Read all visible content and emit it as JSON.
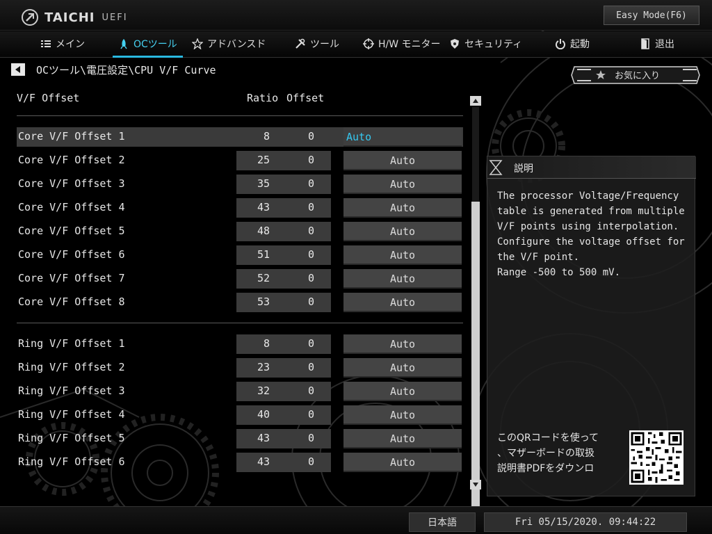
{
  "header": {
    "brand": "TAICHI",
    "brand_sub": "UEFI",
    "easy_mode_label": "Easy Mode(F6)"
  },
  "nav": {
    "tabs": [
      {
        "label": "メイン",
        "icon": "list-icon"
      },
      {
        "label": "OCツール",
        "icon": "rocket-icon",
        "active": true
      },
      {
        "label": "アドバンスド",
        "icon": "star-icon"
      },
      {
        "label": "ツール",
        "icon": "tools-icon"
      },
      {
        "label": "H/W モニター",
        "icon": "crosshair-icon"
      },
      {
        "label": "セキュリティ",
        "icon": "shield-icon"
      },
      {
        "label": "起動",
        "icon": "power-icon"
      },
      {
        "label": "退出",
        "icon": "exit-door-icon"
      }
    ]
  },
  "breadcrumb": "OCツール\\電圧設定\\CPU V/F Curve",
  "favorites_label": "お気に入り",
  "list": {
    "headers": {
      "name": "V/F Offset",
      "ratio": "Ratio",
      "offset": "Offset"
    },
    "core_rows": [
      {
        "name": "Core V/F Offset 1",
        "ratio": "8",
        "offset": "0",
        "value": "Auto"
      },
      {
        "name": "Core V/F Offset 2",
        "ratio": "25",
        "offset": "0",
        "value": "Auto"
      },
      {
        "name": "Core V/F Offset 3",
        "ratio": "35",
        "offset": "0",
        "value": "Auto"
      },
      {
        "name": "Core V/F Offset 4",
        "ratio": "43",
        "offset": "0",
        "value": "Auto"
      },
      {
        "name": "Core V/F Offset 5",
        "ratio": "48",
        "offset": "0",
        "value": "Auto"
      },
      {
        "name": "Core V/F Offset 6",
        "ratio": "51",
        "offset": "0",
        "value": "Auto"
      },
      {
        "name": "Core V/F Offset 7",
        "ratio": "52",
        "offset": "0",
        "value": "Auto"
      },
      {
        "name": "Core V/F Offset 8",
        "ratio": "53",
        "offset": "0",
        "value": "Auto"
      }
    ],
    "ring_rows": [
      {
        "name": "Ring V/F Offset 1",
        "ratio": "8",
        "offset": "0",
        "value": "Auto"
      },
      {
        "name": "Ring V/F Offset 2",
        "ratio": "23",
        "offset": "0",
        "value": "Auto"
      },
      {
        "name": "Ring V/F Offset 3",
        "ratio": "32",
        "offset": "0",
        "value": "Auto"
      },
      {
        "name": "Ring V/F Offset 4",
        "ratio": "40",
        "offset": "0",
        "value": "Auto"
      },
      {
        "name": "Ring V/F Offset 5",
        "ratio": "43",
        "offset": "0",
        "value": "Auto"
      },
      {
        "name": "Ring V/F Offset 6",
        "ratio": "43",
        "offset": "0",
        "value": "Auto"
      }
    ]
  },
  "description": {
    "title": "説明",
    "text": "The processor Voltage/Frequency\ntable is generated from multiple\nV/F points using interpolation.\nConfigure the voltage offset for\nthe V/F point.\nRange -500 to 500 mV.",
    "qr_text": "このQRコードを使って\n、マザーボードの取扱\n説明書PDFをダウンロ"
  },
  "footer": {
    "language": "日本語",
    "datetime": "Fri 05/15/2020. 09:44:22"
  },
  "colors": {
    "accent": "#35c8f0",
    "selected_row": "#3a3a3a",
    "field": "#444444"
  }
}
